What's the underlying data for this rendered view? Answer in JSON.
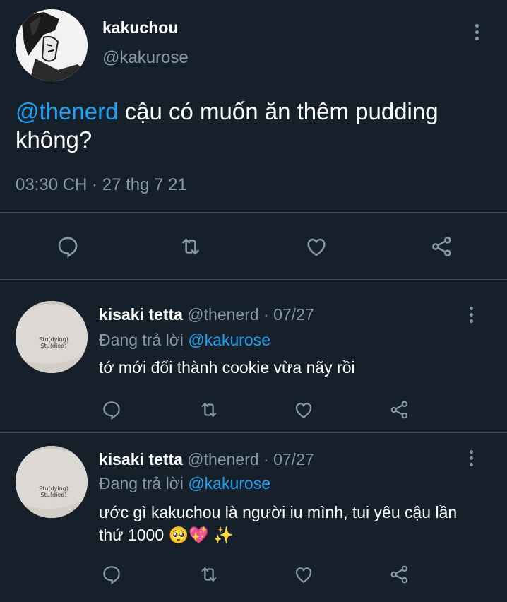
{
  "main_tweet": {
    "display_name": "kakuchou",
    "handle": "@kakurose",
    "mention": "@thenerd",
    "text": " cậu có muốn ăn thêm pudding không?",
    "time": "03:30 CH",
    "separator": " · ",
    "date": "27 thg 7 21"
  },
  "replies": [
    {
      "display_name": "kisaki tetta",
      "handle": "@thenerd",
      "date": " · 07/27",
      "replying_prefix": "Đang trả lời ",
      "replying_to": "@kakurose",
      "text": "tớ mới đổi thành cookie vừa nãy rồi",
      "avatar_shirt_line1": "Stu(dying)",
      "avatar_shirt_line2": "Stu(died)"
    },
    {
      "display_name": "kisaki tetta",
      "handle": "@thenerd",
      "date": " · 07/27",
      "replying_prefix": "Đang trả lời ",
      "replying_to": "@kakurose",
      "text": "ước gì kakuchou là người iu mình, tui yêu cậu lần thứ 1000 🥺💖 ✨",
      "avatar_shirt_line1": "Stu(dying)",
      "avatar_shirt_line2": "Stu(died)"
    }
  ],
  "icons": {
    "reply": "speech-bubble-icon",
    "retweet": "retweet-icon",
    "like": "heart-icon",
    "share": "share-icon",
    "more": "vertical-dots-icon"
  },
  "colors": {
    "background": "#15202b",
    "text": "#ffffff",
    "secondary": "#8899a6",
    "accent": "#1da1f2",
    "divider": "#38444d"
  }
}
